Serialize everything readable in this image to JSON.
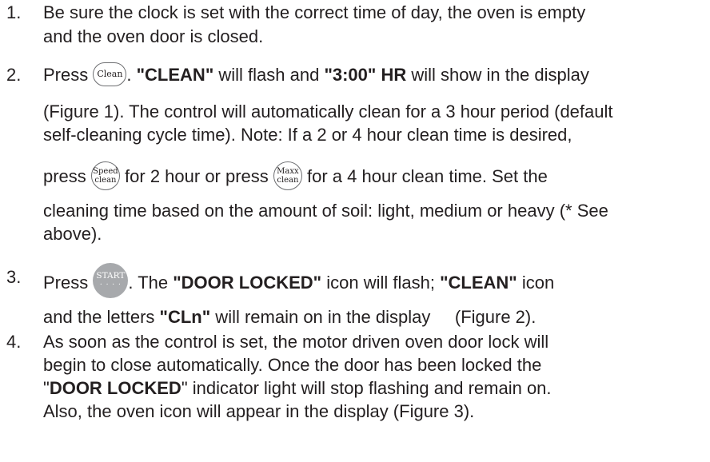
{
  "steps": [
    {
      "number": "1.",
      "lines": [
        "Be sure the clock is set with the correct time of day, the oven is empty",
        "and the oven door is closed."
      ]
    },
    {
      "number": "2.",
      "press": "Press",
      "clean_key": "Clean",
      "after_key": ". ",
      "clean_quote": "\"CLEAN\"",
      "flash_text": " will flash and ",
      "time_quote": "\"3:00\" HR",
      "display_text": " will show in the display",
      "line2": "(Figure 1). The control will automatically clean for a 3 hour period (default",
      "line3": "self-cleaning cycle time). Note: If a 2 or 4 hour clean time is desired,",
      "press_lower": "press",
      "speed_key_top": "Speed",
      "speed_key_bottom": "clean",
      "two_hour_text": " for 2 hour or press ",
      "maxx_key_top": "Maxx",
      "maxx_key_bottom": "clean",
      "four_hour_text": " for a 4 hour clean time.  Set the",
      "line5": "cleaning time based on the amount of soil: light, medium or heavy (* See",
      "line6": "above)."
    },
    {
      "number": "3.",
      "press": "Press",
      "start_key": "START",
      "start_dots": ". . . .",
      "after_key": ". The ",
      "door_locked_quote": "\"DOOR LOCKED\"",
      "flash_text": " icon will flash; ",
      "clean_quote": "\"CLEAN\"",
      "icon_text": " icon",
      "line2_a": "and the letters ",
      "cln_quote": "\"CLn\"",
      "line2_b": " will remain on in the display     (Figure 2)."
    },
    {
      "number": "4.",
      "line1": "As soon as the control is set, the motor driven oven door lock will",
      "line2": "begin to close automatically. Once the door has been locked the",
      "line3_a": "\"",
      "door_locked": "DOOR LOCKED",
      "line3_b": "\" indicator light will stop flashing and remain on.",
      "line4": "Also, the oven icon will appear in the display (Figure 3)."
    }
  ]
}
